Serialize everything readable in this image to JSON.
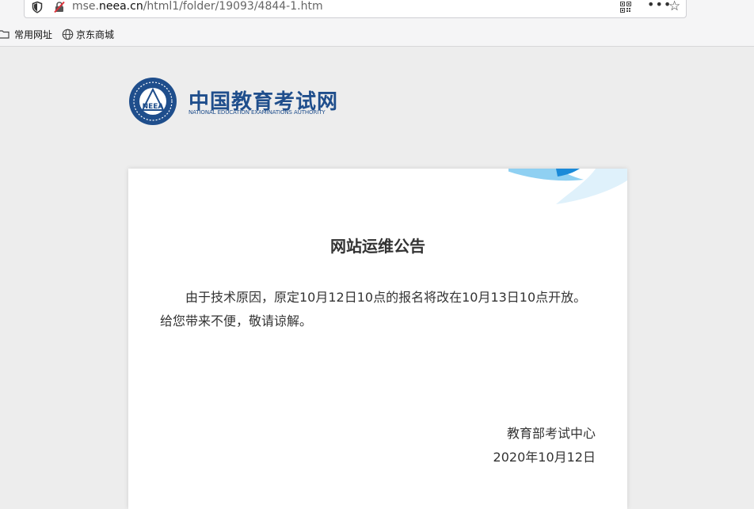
{
  "browser": {
    "url_prefix": "mse.",
    "url_domain": "neea.cn",
    "url_path": "/html1/folder/19093/4844-1.htm",
    "more_label": "•••",
    "bookmarks": [
      {
        "label": "常用网址"
      },
      {
        "label": "京东商城"
      }
    ]
  },
  "logo": {
    "title": "中国教育考试网",
    "subtitle": "NATIONAL EDUCATION EXAMINATIONS AUTHORITY",
    "emblem_text": "NEEA"
  },
  "notice": {
    "title": "网站运维公告",
    "body": "由于技术原因，原定10月12日10点的报名将改在10月13日10点开放。给您带来不便，敬请谅解。",
    "sign_org": "教育部考试中心",
    "sign_date": "2020年10月12日"
  },
  "colors": {
    "brand": "#1f4e8c",
    "accent": "#1a8ad8",
    "text": "#333333",
    "page_bg": "#ededed"
  },
  "icons": {
    "shield": "shield-icon",
    "insecure": "insecure-lock-icon",
    "qr": "qr-code-icon",
    "star": "star-icon",
    "folder": "folder-icon",
    "globe": "globe-icon"
  }
}
